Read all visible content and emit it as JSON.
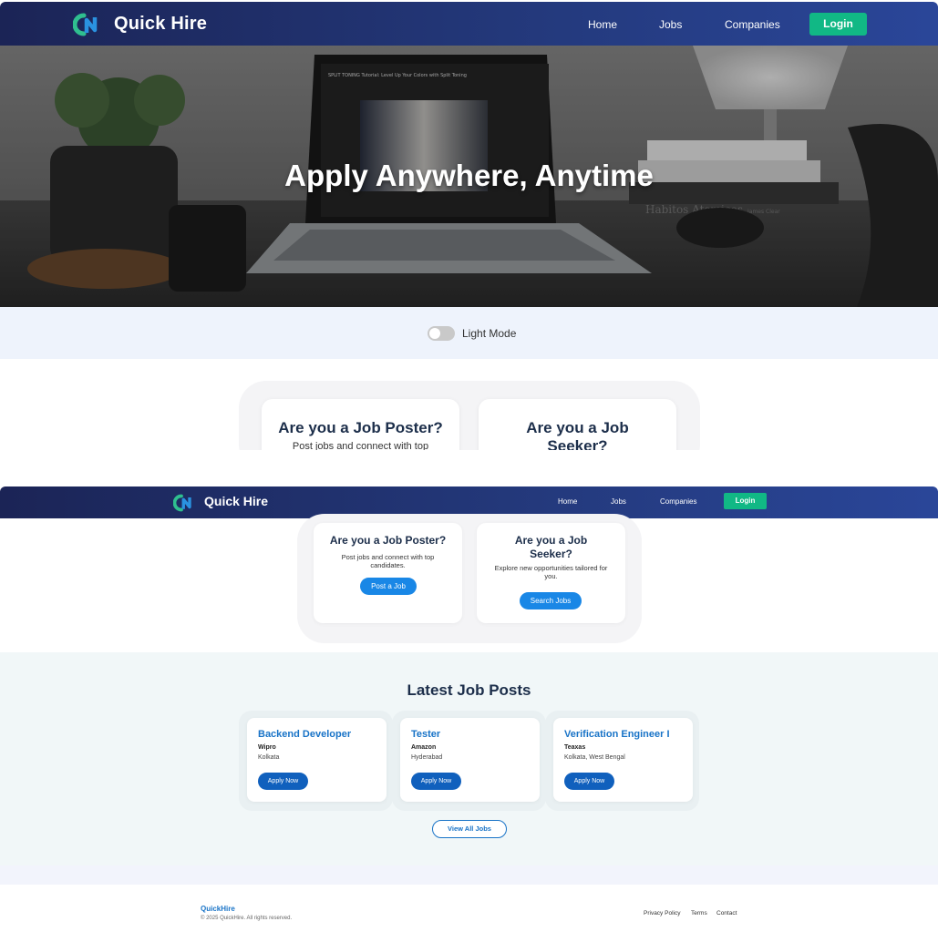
{
  "brand": "Quick Hire",
  "nav": {
    "home": "Home",
    "jobs": "Jobs",
    "companies": "Companies",
    "login": "Login"
  },
  "hero": {
    "title": "Apply Anywhere, Anytime",
    "laptop_screen_text": "SPLIT TONING Tutorial: Level Up Your Colors with Split Toning",
    "book_text": "Habitos Atomicos",
    "book_author": "James Clear"
  },
  "theme_toggle": {
    "label": "Light Mode",
    "state": "off"
  },
  "roles": {
    "poster": {
      "title": "Are you a Job Poster?",
      "description": "Post jobs and connect with top candidates.",
      "description_cut": "Post jobs and connect with top",
      "button": "Post a Job"
    },
    "seeker": {
      "title_line1": "Are you a Job",
      "title_line2": "Seeker?",
      "description": "Explore new opportunities tailored for you.",
      "button": "Search Jobs"
    }
  },
  "latest": {
    "title": "Latest Job Posts",
    "jobs": [
      {
        "title": "Backend Developer",
        "company": "Wipro",
        "location": "Kolkata",
        "button": "Apply Now"
      },
      {
        "title": "Tester",
        "company": "Amazon",
        "location": "Hyderabad",
        "button": "Apply Now"
      },
      {
        "title": "Verification Engineer I",
        "company": "Teaxas",
        "location": "Kolkata, West Bengal",
        "button": "Apply Now"
      }
    ],
    "view_all": "View All Jobs"
  },
  "footer": {
    "brand": "QuickHire",
    "copyright": "© 2025 QuickHire. All rights reserved.",
    "links": [
      "Privacy Policy",
      "Terms",
      "Contact"
    ]
  },
  "colors": {
    "nav_gradient_start": "#1b2456",
    "nav_gradient_end": "#2a4699",
    "login_green": "#11b885",
    "primary_blue": "#1987e6",
    "job_title_blue": "#1873c7",
    "heading_dark": "#1c2e4a"
  },
  "icons": {
    "logo": "quick-hire-logo-icon"
  }
}
